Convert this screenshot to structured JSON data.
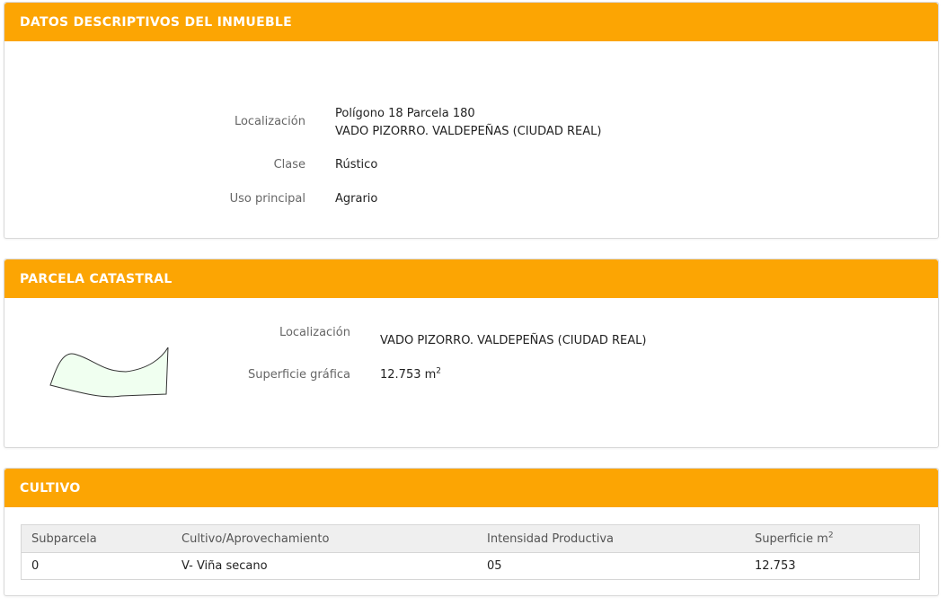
{
  "datos": {
    "title": "DATOS DESCRIPTIVOS DEL INMUEBLE",
    "localizacion_label": "Localización",
    "localizacion_line1": "Polígono 18 Parcela 180",
    "localizacion_line2": "VADO PIZORRO. VALDEPEÑAS (CIUDAD REAL)",
    "clase_label": "Clase",
    "clase_value": "Rústico",
    "uso_label": "Uso principal",
    "uso_value": "Agrario"
  },
  "parcela": {
    "title": "PARCELA CATASTRAL",
    "localizacion_label": "Localización",
    "localizacion_value": "VADO PIZORRO. VALDEPEÑAS (CIUDAD REAL)",
    "superficie_label": "Superficie gráfica",
    "superficie_value": "12.753 m",
    "superficie_sup": "2"
  },
  "cultivo": {
    "title": "CULTIVO",
    "headers": [
      "Subparcela",
      "Cultivo/Aprovechamiento",
      "Intensidad Productiva",
      "Superficie m"
    ],
    "header_sup": "2",
    "rows": [
      [
        "0",
        "V- Viña secano",
        "05",
        "12.753"
      ]
    ]
  }
}
